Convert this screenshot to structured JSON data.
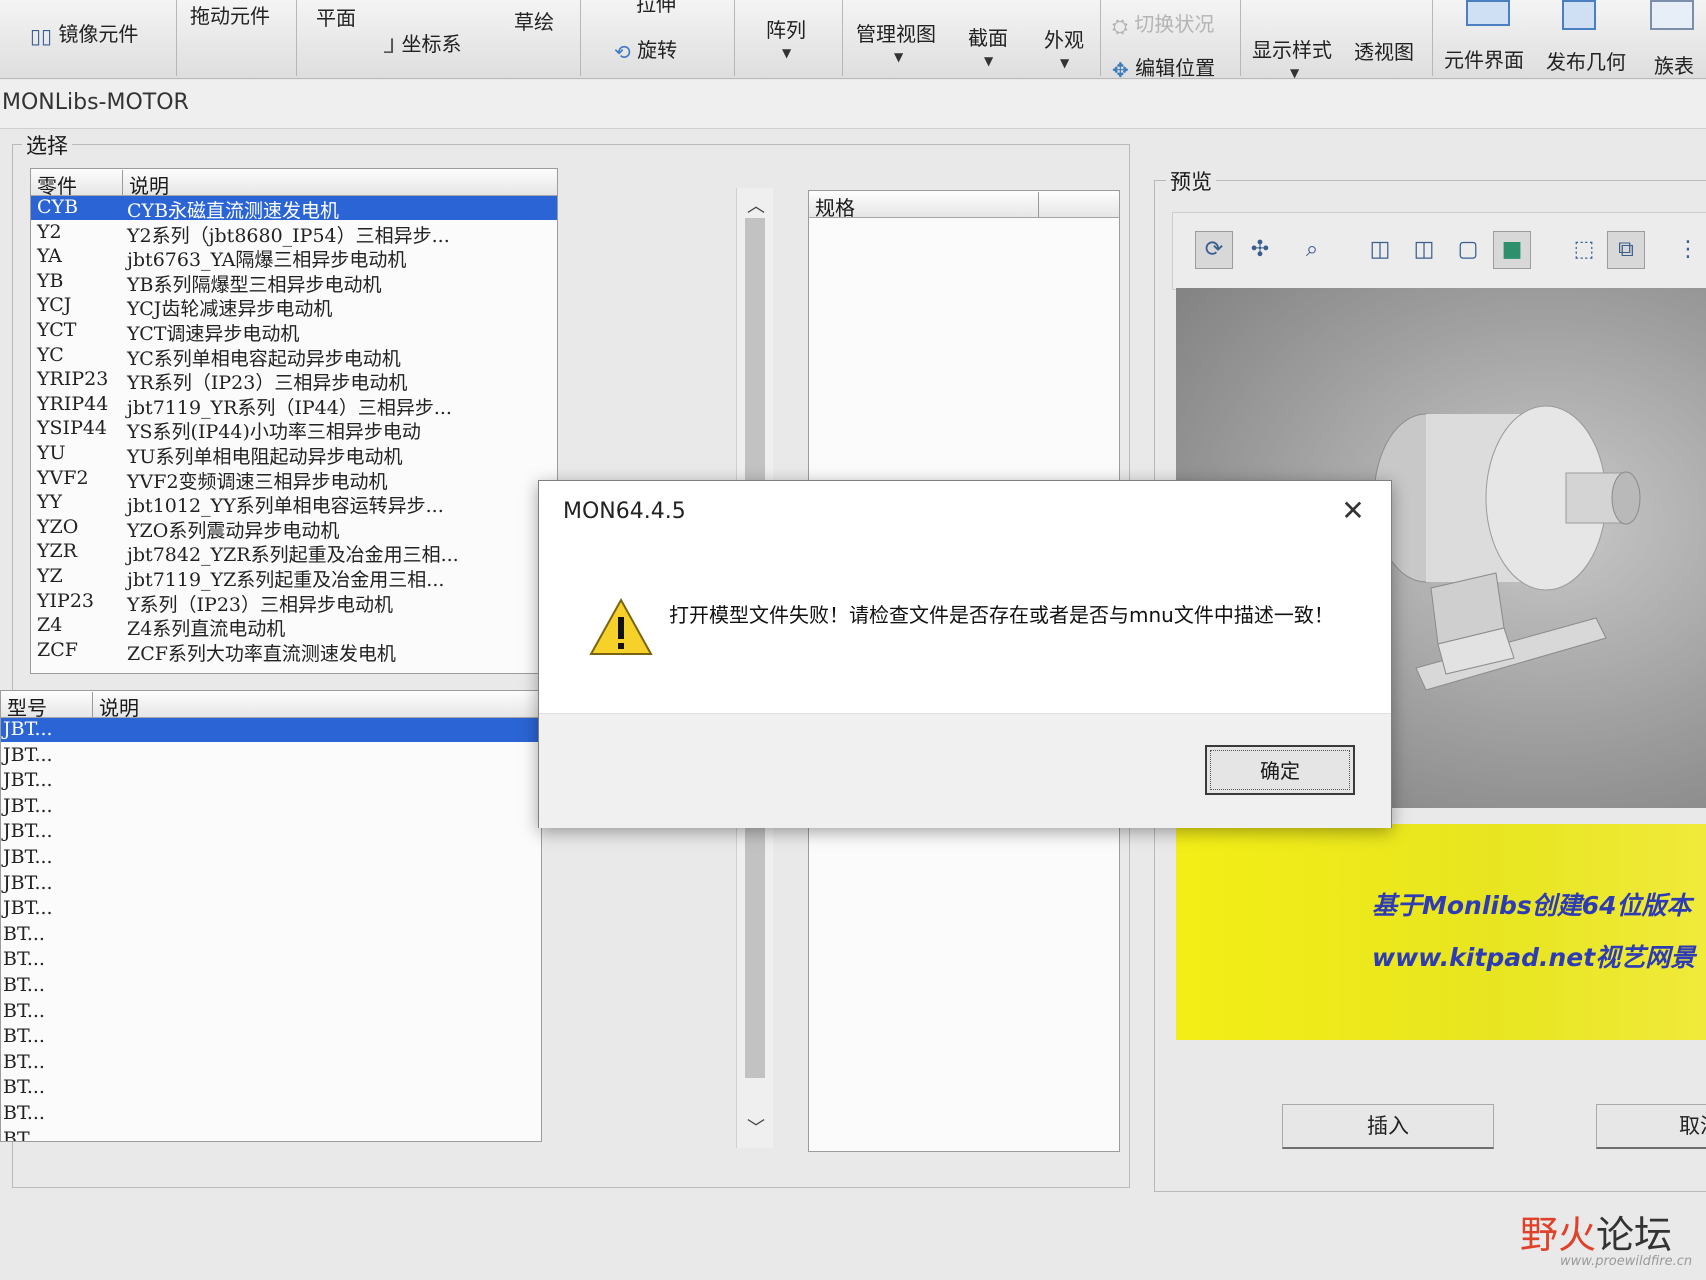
{
  "ribbon": {
    "mirror_element": "镜像元件",
    "drag_element": "拖动元件",
    "plane": "平面",
    "coordinate_system": "坐标系",
    "sketch": "草绘",
    "extrude": "拉伸",
    "revolve": "旋转",
    "pattern": "阵列",
    "manage_views": "管理视图",
    "section": "截面",
    "appearance": "外观",
    "switch_state": "切换状况",
    "edit_position": "编辑位置",
    "display_style": "显示样式",
    "perspective": "透视图",
    "element_interface": "元件界面",
    "publish_geometry": "发布几何",
    "family_table": "族表"
  },
  "window": {
    "title": "MONLibs-MOTOR"
  },
  "select_group": {
    "label": "选择",
    "parts_header": [
      "零件",
      "说明"
    ],
    "parts": [
      {
        "code": "CYB",
        "desc": "CYB永磁直流测速发电机",
        "selected": true
      },
      {
        "code": "Y2",
        "desc": "Y2系列（jbt8680_IP54）三相异步..."
      },
      {
        "code": "YA",
        "desc": "jbt6763_YA隔爆三相异步电动机"
      },
      {
        "code": "YB",
        "desc": "YB系列隔爆型三相异步电动机"
      },
      {
        "code": "YCJ",
        "desc": "YCJ齿轮减速异步电动机"
      },
      {
        "code": "YCT",
        "desc": "YCT调速异步电动机"
      },
      {
        "code": "YC",
        "desc": "YC系列单相电容起动异步电动机"
      },
      {
        "code": "YRIP23",
        "desc": "YR系列（IP23）三相异步电动机"
      },
      {
        "code": "YRIP44",
        "desc": "jbt7119_YR系列（IP44）三相异步..."
      },
      {
        "code": "YSIP44",
        "desc": "YS系列(IP44)小功率三相异步电动"
      },
      {
        "code": "YU",
        "desc": "YU系列单相电阻起动异步电动机"
      },
      {
        "code": "YVF2",
        "desc": "YVF2变频调速三相异步电动机"
      },
      {
        "code": "YY",
        "desc": "jbt1012_YY系列单相电容运转异步..."
      },
      {
        "code": "YZO",
        "desc": "YZO系列震动异步电动机"
      },
      {
        "code": "YZR",
        "desc": "jbt7842_YZR系列起重及冶金用三相..."
      },
      {
        "code": "YZ",
        "desc": "jbt7119_YZ系列起重及冶金用三相..."
      },
      {
        "code": "YIP23",
        "desc": "Y系列（IP23）三相异步电动机"
      },
      {
        "code": "Z4",
        "desc": "Z4系列直流电动机"
      },
      {
        "code": "ZCF",
        "desc": "ZCF系列大功率直流测速发电机"
      }
    ],
    "models_header": [
      "型号",
      "说明"
    ],
    "models": [
      "JBT...",
      "JBT...",
      "JBT...",
      "JBT...",
      "JBT...",
      "JBT...",
      "JBT...",
      "JBT...",
      "BT...",
      "BT...",
      "BT...",
      "BT...",
      "BT...",
      "BT...",
      "BT...",
      "BT...",
      "BT..."
    ],
    "spec_header": "规格"
  },
  "preview": {
    "label": "预览",
    "banner_line1": "基于Monlibs创建64位版本",
    "banner_line2": "www.kitpad.net视艺网景"
  },
  "buttons": {
    "insert": "插入",
    "cancel": "取消"
  },
  "dialog": {
    "title": "MON64.4.5",
    "message": "打开模型文件失败！请检查文件是否存在或者是否与mnu文件中描述一致！",
    "ok": "确定"
  },
  "watermark": {
    "logo_red": "野火",
    "logo_dark": "论坛",
    "url": "www.proewildfire.cn"
  }
}
